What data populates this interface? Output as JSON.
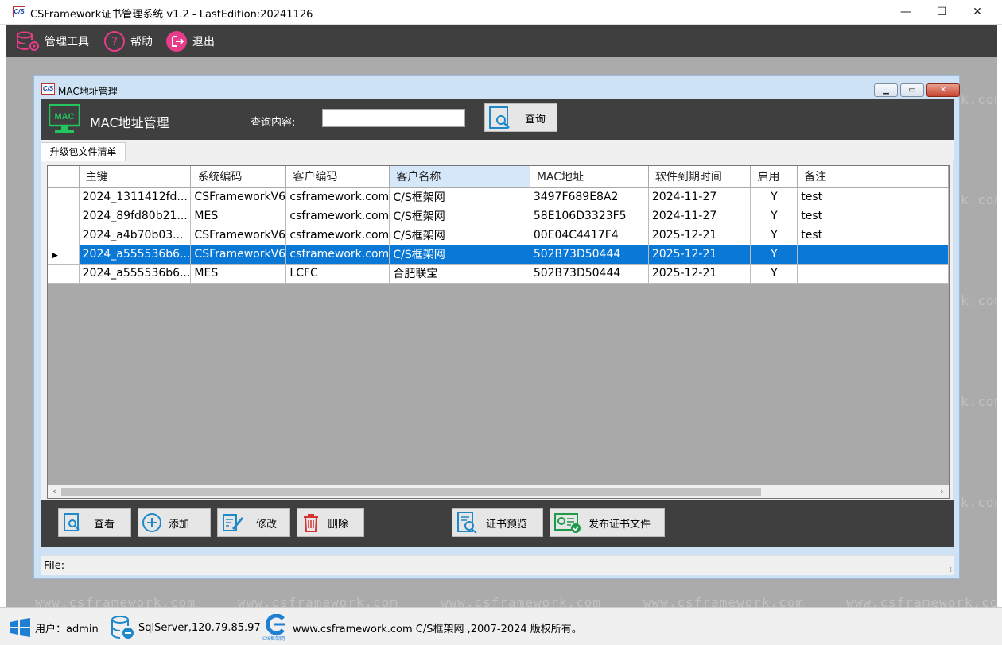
{
  "window": {
    "title": "CSFramework证书管理系统 v1.2 - LastEdition:20241126",
    "app_icon_text": "C/S",
    "minimize": "—",
    "maximize": "☐",
    "close": "✕"
  },
  "menu": {
    "tools": "管理工具",
    "help": "帮助",
    "exit": "退出"
  },
  "watermark": "www.csframework.com",
  "watermark_partial": "k.com",
  "form": {
    "title": "MAC地址管理",
    "icon_text": "C/S",
    "logo_text": "MAC",
    "header_title": "MAC地址管理",
    "search_label": "查询内容:",
    "search_value": "",
    "query_button": "查询",
    "tab": "升级包文件清单",
    "status": "File:"
  },
  "table": {
    "columns": [
      "主键",
      "系统编码",
      "客户编码",
      "客户名称",
      "MAC地址",
      "软件到期时间",
      "启用",
      "备注"
    ],
    "sorted_column": 3,
    "selected_row": 3,
    "rows": [
      [
        "2024_1311412fd...",
        "CSFrameworkV6",
        "csframework.com",
        "C/S框架网",
        "3497F689E8A2",
        "2024-11-27",
        "Y",
        "test"
      ],
      [
        "2024_89fd80b21...",
        "MES",
        "csframework.com",
        "C/S框架网",
        "58E106D3323F5",
        "2024-11-27",
        "Y",
        "test"
      ],
      [
        "2024_a4b70b03...",
        "CSFrameworkV6",
        "csframework.com",
        "C/S框架网",
        "00E04C4417F4",
        "2025-12-21",
        "Y",
        "test"
      ],
      [
        "2024_a555536b6...",
        "CSFrameworkV6",
        "csframework.com",
        "C/S框架网",
        "502B73D50444",
        "2025-12-21",
        "Y",
        ""
      ],
      [
        "2024_a555536b6...",
        "MES",
        "LCFC",
        "合肥联宝",
        "502B73D50444",
        "2025-12-21",
        "Y",
        ""
      ]
    ]
  },
  "actions": {
    "view": "查看",
    "add": "添加",
    "edit": "修改",
    "delete": "删除",
    "preview": "证书预览",
    "publish": "发布证书文件"
  },
  "footer": {
    "user": "用户：admin",
    "server": "SqlServer,120.79.85.97",
    "logo_text": "C/S框架网",
    "copyright": "www.csframework.com C/S框架网 ,2007-2024 版权所有。"
  },
  "colors": {
    "dark_band": "#3f3f3f",
    "selection": "#0a78d7",
    "mac_green": "#22c55e"
  }
}
